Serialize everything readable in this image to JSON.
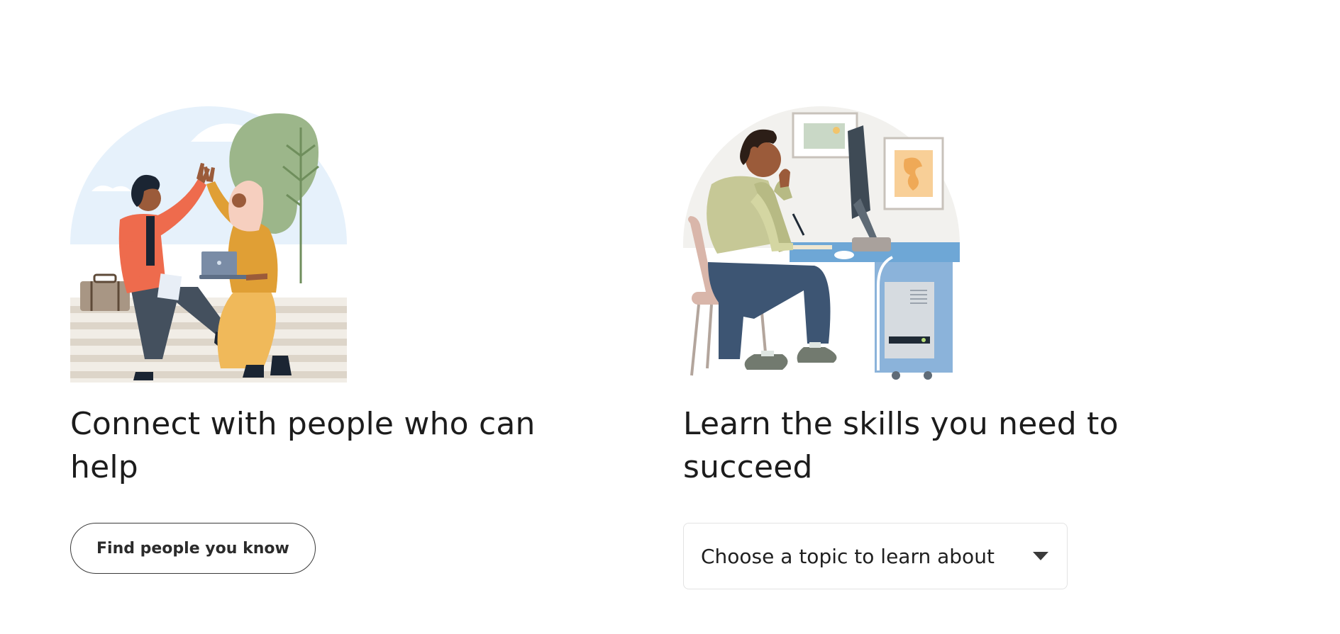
{
  "connect_section": {
    "headline": "Connect with people who can help",
    "button_label": "Find people you know"
  },
  "learn_section": {
    "headline": "Learn the skills you need to succeed",
    "select_label": "Choose a topic to learn about"
  }
}
